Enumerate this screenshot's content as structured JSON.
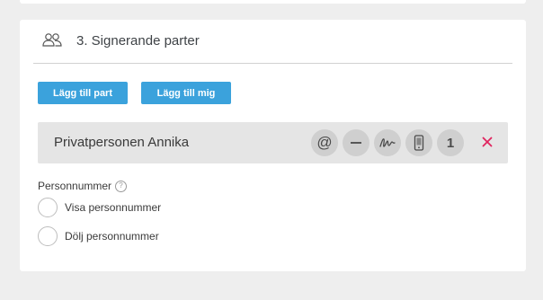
{
  "section": {
    "title": "3. Signerande parter",
    "icon": "people-icon"
  },
  "buttons": {
    "add_party": "Lägg till part",
    "add_me": "Lägg till mig"
  },
  "party": {
    "name": "Privatpersonen Annika",
    "email_glyph": "@",
    "signing_order": "1",
    "icons": [
      "at-icon",
      "minus-icon",
      "signature-icon",
      "mobile-phone-icon",
      "close-icon"
    ]
  },
  "personal_number": {
    "label": "Personnummer",
    "help_glyph": "?",
    "options": [
      "Visa personnummer",
      "Dölj personnummer"
    ]
  },
  "colors": {
    "primary": "#3ba2dc",
    "remove": "#e0245e",
    "party_bg": "#e5e5e5",
    "page_bg": "#eeeeee"
  }
}
